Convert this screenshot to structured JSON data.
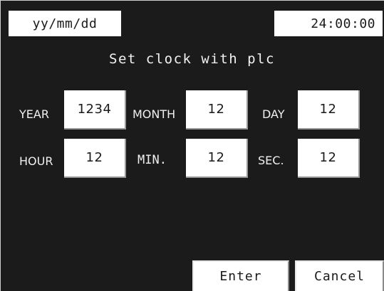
{
  "header": {
    "date_format": "yy/mm/dd",
    "time": "24:00:00"
  },
  "title": "Set clock with plc",
  "fields": {
    "year": {
      "label": "YEAR",
      "value": "1234"
    },
    "month": {
      "label": "MONTH",
      "value": "12"
    },
    "day": {
      "label": "DAY",
      "value": "12"
    },
    "hour": {
      "label": "HOUR",
      "value": "12"
    },
    "minute": {
      "label": "MIN.",
      "value": "12"
    },
    "second": {
      "label": "SEC.",
      "value": "12"
    }
  },
  "buttons": {
    "enter": "Enter",
    "cancel": "Cancel"
  },
  "colors": {
    "background": "#1b1b1b",
    "field": "#ffffff",
    "text_on_dark": "#ffffff",
    "text_on_field": "#1a1a1a"
  }
}
